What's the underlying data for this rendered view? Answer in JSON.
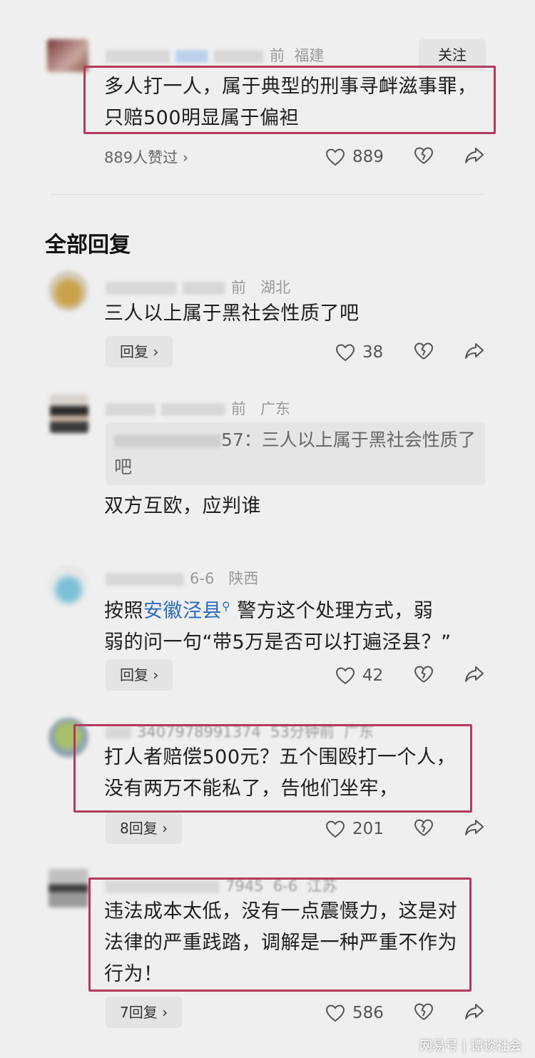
{
  "top_comment": {
    "location": "福建",
    "follow_label": "关注",
    "time_suffix": "前",
    "text": "多人打一人，属于典型的刑事寻衅滋事罪，只赔500明显属于偏袒",
    "liked_by": "889人赞过 ›",
    "likes": "889"
  },
  "section_title": "全部回复",
  "replies": [
    {
      "time_suffix": "前",
      "location": "湖北",
      "text": "三人以上属于黑社会性质了吧",
      "reply_label": "回复 ›",
      "likes": "38"
    },
    {
      "time_suffix": "前",
      "location": "广东",
      "quote_suffix": "57：三人以上属于黑社会性质了吧",
      "text": "双方互欧，应判谁"
    },
    {
      "date": "6-6",
      "location": "陕西",
      "text_before": "按照",
      "link": "安徽泾县",
      "text_after_line1": " 警方这个处理方式，弱",
      "text_line2": "弱的问一句“带5万是否可以打遍泾县？”",
      "reply_label": "回复 ›",
      "likes": "42"
    },
    {
      "id_partial": "3407978991374",
      "time": "53分钟前",
      "location": "广东",
      "text": "打人者赔偿500元？五个围殴打一个人，没有两万不能私了，告他们坐牢，",
      "reply_label": "8回复 ›",
      "likes": "201"
    },
    {
      "id_partial": "7945",
      "date": "6-6",
      "location": "江苏",
      "text": "违法成本太低，没有一点震慑力，这是对法律的严重践踏，调解是一种严重不作为行为！",
      "reply_label": "7回复 ›",
      "likes": "586"
    }
  ],
  "watermark": {
    "brand": "网易号",
    "account": "谭谈社会"
  },
  "colors": {
    "background": "#efefef",
    "highlight_box": "#b23a5c",
    "link": "#2a6bbd"
  }
}
